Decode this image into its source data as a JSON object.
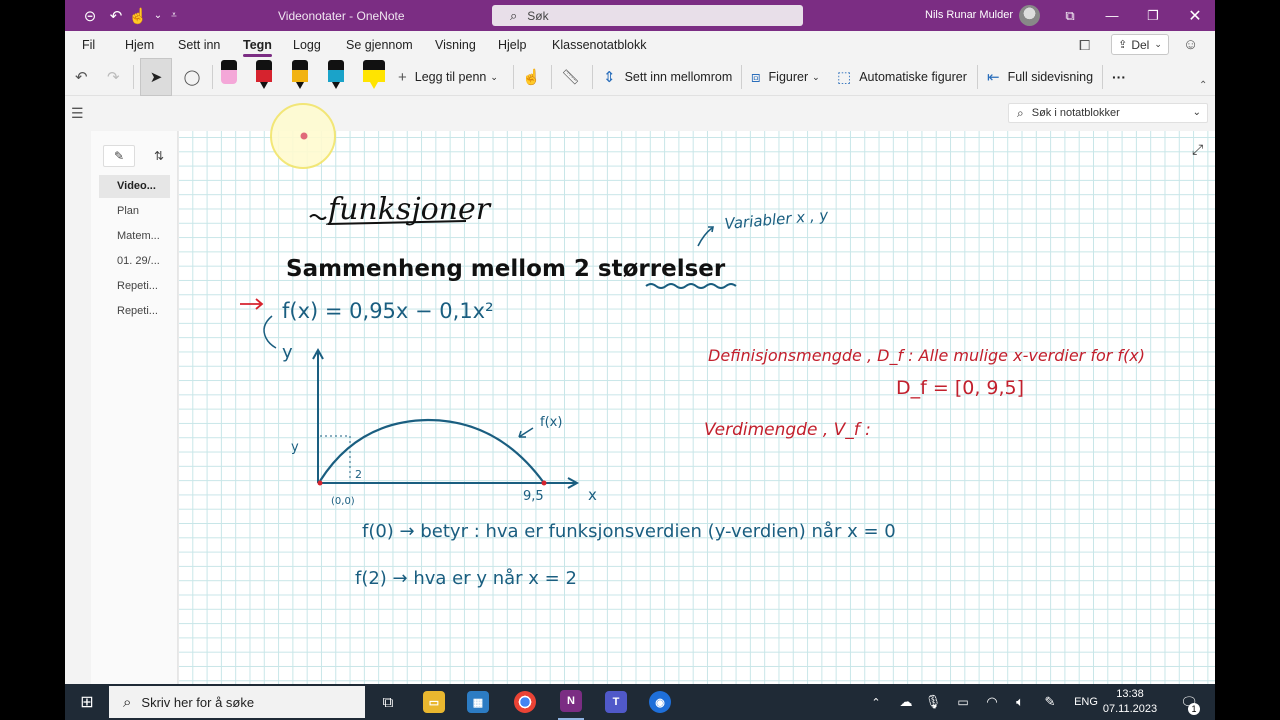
{
  "titlebar": {
    "title": "Videonotater  -  OneNote",
    "search_placeholder": "Søk",
    "user_name": "Nils Runar Mulder"
  },
  "menu": {
    "items": [
      "Fil",
      "Hjem",
      "Sett inn",
      "Tegn",
      "Logg",
      "Se gjennom",
      "Visning",
      "Hjelp",
      "Klassenotatblokk"
    ],
    "active": "Tegn",
    "share_label": "Del"
  },
  "ribbon": {
    "add_pen": "Legg til penn",
    "insert_space": "Sett inn mellomrom",
    "shapes": "Figurer",
    "auto_shapes": "Automatiske figurer",
    "fullscreen": "Full sidevisning",
    "more": "···",
    "pen_colors": [
      "#f4a7d8",
      "#d6232e",
      "#f2b312",
      "#1aa3c9",
      "#ffe400"
    ]
  },
  "notebook_search": {
    "placeholder": "Søk i notatblokker"
  },
  "pages": {
    "items": [
      "Video...",
      "Plan",
      "Matem...",
      "01. 29/...",
      "Repeti...",
      "Repeti..."
    ],
    "active_index": 0
  },
  "ink": {
    "title": "funksjoner",
    "line1": "Sammenheng mellom 2 størrelser",
    "note_variables": "Variabler x , y",
    "formula": "f(x) = 0,95x − 0,1x²",
    "y_axis": "y",
    "x_axis": "x",
    "curve_label": "f(x)",
    "y_tick": "y",
    "x_tick_2": "2",
    "origin": "(0,0)",
    "x_end": "9,5",
    "def_domain": "Definisjonsmengde , D_f :  Alle mulige x-verdier for f(x)",
    "domain_value": "D_f = [0, 9,5]",
    "range_label": "Verdimengde , V_f :",
    "f0_line": "f(0) → betyr : hva er funksjonsverdien (y-verdien) når x = 0",
    "f2_line": "f(2) → hva er y når x = 2"
  },
  "taskbar": {
    "search_placeholder": "Skriv her for å søke",
    "language": "ENG",
    "time": "13:38",
    "date": "07.11.2023",
    "notification_count": "1"
  }
}
